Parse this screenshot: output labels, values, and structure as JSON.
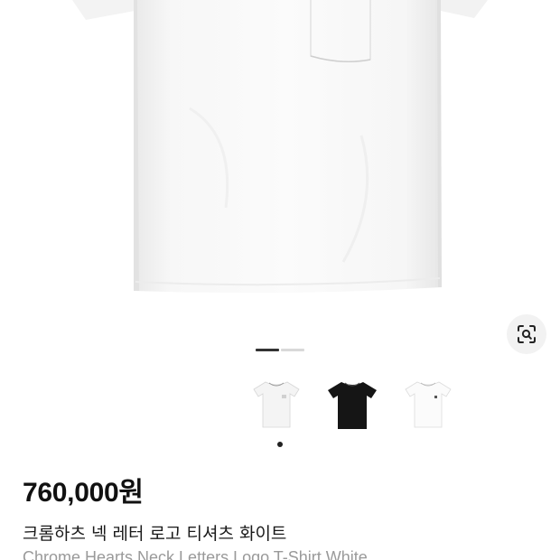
{
  "product": {
    "price": "760,000원",
    "title_ko": "크롬하츠 넥 레터 로고 티셔츠 화이트",
    "title_en": "Chrome Hearts Neck Letters Logo T-Shirt White"
  },
  "gallery": {
    "total_pages": 2,
    "active_page": 1,
    "variants": [
      {
        "color": "#f4f4f4",
        "name": "white"
      },
      {
        "color": "#151515",
        "name": "black"
      },
      {
        "color": "#fbfbfb",
        "name": "white"
      }
    ],
    "selected_variant": 1
  },
  "icons": {
    "lens": "image-search-icon"
  }
}
